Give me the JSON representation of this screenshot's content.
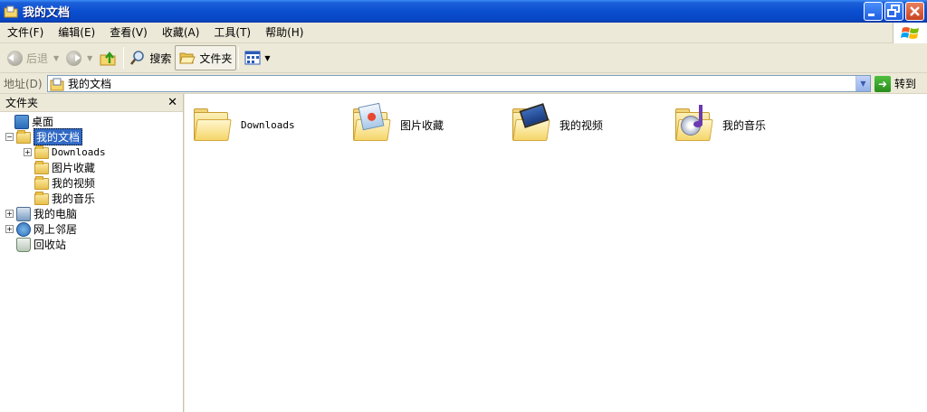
{
  "window": {
    "title": "我的文档",
    "minimize_icon": "minimize-icon",
    "maximize_icon": "restore-icon",
    "close_icon": "close-icon"
  },
  "menu": {
    "items": [
      "文件(F)",
      "编辑(E)",
      "查看(V)",
      "收藏(A)",
      "工具(T)",
      "帮助(H)"
    ]
  },
  "toolbar": {
    "back_label": "后退",
    "search_label": "搜索",
    "folders_label": "文件夹"
  },
  "address": {
    "label": "地址(D)",
    "value": "我的文档",
    "go_label": "转到"
  },
  "folder_pane": {
    "title": "文件夹",
    "close_glyph": "✕",
    "tree": [
      {
        "label": "桌面",
        "icon": "desktop-icon"
      },
      {
        "label": "我的文档",
        "icon": "my-documents-icon",
        "selected": true
      },
      {
        "label": "Downloads",
        "icon": "folder-icon"
      },
      {
        "label": "图片收藏",
        "icon": "pictures-folder-icon"
      },
      {
        "label": "我的视频",
        "icon": "videos-folder-icon"
      },
      {
        "label": "我的音乐",
        "icon": "music-folder-icon"
      },
      {
        "label": "我的电脑",
        "icon": "my-computer-icon"
      },
      {
        "label": "网上邻居",
        "icon": "network-places-icon"
      },
      {
        "label": "回收站",
        "icon": "recycle-bin-icon"
      }
    ]
  },
  "content": {
    "items": [
      {
        "label": "Downloads",
        "icon": "folder-icon"
      },
      {
        "label": "图片收藏",
        "icon": "pictures-folder-icon"
      },
      {
        "label": "我的视频",
        "icon": "videos-folder-icon"
      },
      {
        "label": "我的音乐",
        "icon": "music-folder-icon"
      }
    ]
  },
  "colors": {
    "titlebar": "#0a4fd0",
    "selection": "#316ac5",
    "chrome": "#ece9d8"
  }
}
